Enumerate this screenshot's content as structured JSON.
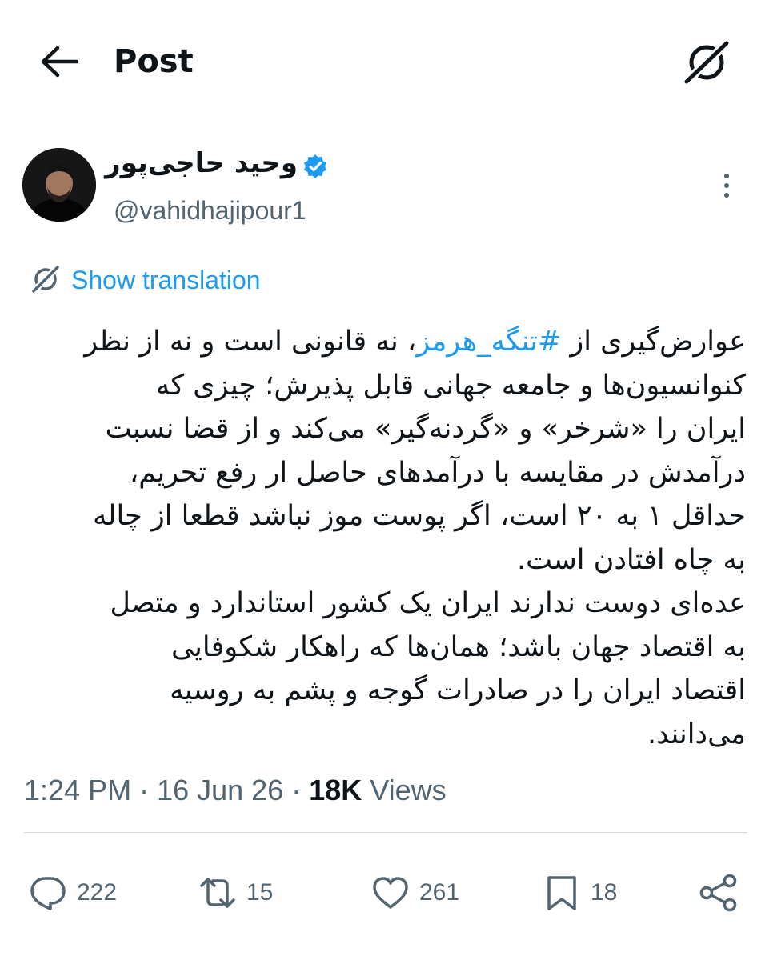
{
  "header": {
    "title": "Post",
    "back_icon": "arrow-left-icon",
    "grok_icon": "grok-icon"
  },
  "author": {
    "display_name": "وحید حاجی‌پور",
    "handle": "@vahidhajipour1",
    "verified": true,
    "verified_color": "#1d9bf0"
  },
  "translation": {
    "label": "Show translation"
  },
  "post": {
    "lines": [
      {
        "before": "عوارض‌گیری از ",
        "hashtag": "#تنگه_هرمز",
        "after": "، نه قانونی است و نه از نظر"
      },
      {
        "text": "کنوانسیون‌ها و جامعه جهانی قابل پذیرش؛ چیزی که"
      },
      {
        "text": "ایران را «شرخر» و «گردنه‌گیر» می‌کند و از قضا نسبت"
      },
      {
        "text": "درآمدش در مقایسه با درآمدهای حاصل ار رفع تحریم،"
      },
      {
        "text": "حداقل ۱ به ۲۰ است، اگر پوست موز نباشد قطعا از چاله"
      },
      {
        "text": "به چاه افتادن است."
      },
      {
        "text": "عده‌ای دوست ندارند ایران یک کشور استاندارد و متصل"
      },
      {
        "text": "به اقتصاد جهان باشد؛ همان‌ها که راهکار شکوفایی"
      },
      {
        "text": "اقتصاد ایران را در صادرات گوجه و پشم به روسیه"
      },
      {
        "text": "می‌دانند."
      }
    ]
  },
  "meta": {
    "time": "1:24 PM",
    "separator": " · ",
    "date": "16 Jun 26",
    "views_count": "18K",
    "views_label": " Views"
  },
  "actions": {
    "replies": "222",
    "reposts": "15",
    "likes": "261",
    "bookmarks": "18"
  },
  "colors": {
    "accent": "#1d9bf0",
    "text": "#0f1419",
    "muted": "#536471",
    "divider": "#cfd9de"
  }
}
